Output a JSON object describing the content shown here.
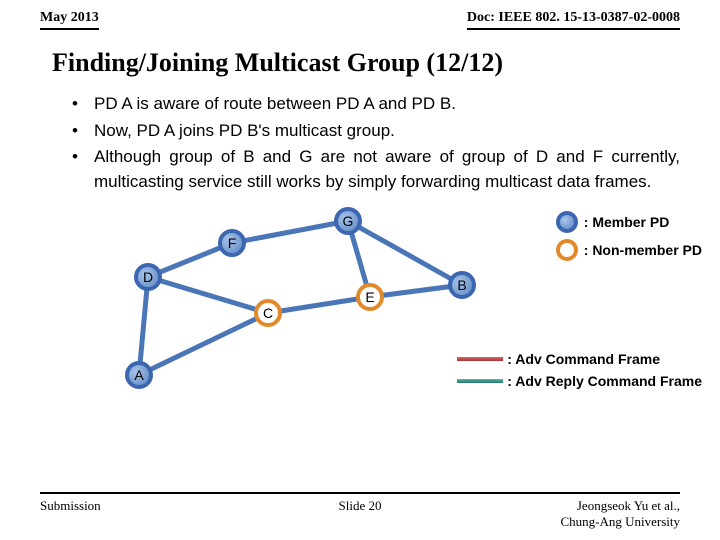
{
  "header": {
    "date": "May 2013",
    "doc": "Doc: IEEE 802. 15-13-0387-02-0008"
  },
  "title": "Finding/Joining Multicast Group (12/12)",
  "bullets": [
    "PD A is aware of route between PD A and PD B.",
    "Now, PD A joins PD B's multicast group.",
    "Although group of B and G are not aware of group of D and F currently, multicasting service still works by simply forwarding multicast data frames."
  ],
  "nodes": {
    "A": "A",
    "B": "B",
    "C": "C",
    "D": "D",
    "E": "E",
    "F": "F",
    "G": "G"
  },
  "legend": {
    "member": ": Member PD",
    "nonmember": ": Non-member PD",
    "cmd": ": Adv Command Frame",
    "reply": ": Adv Reply Command Frame"
  },
  "colors": {
    "member_border": "#3c66b0",
    "nonmember_border": "#e28a2a",
    "edge": "#4a76b8",
    "cmd_line": "#c44a4a",
    "reply_line": "#3d9a6a"
  },
  "footer": {
    "left": "Submission",
    "center": "Slide 20",
    "author": "Jeongseok Yu et al., ",
    "affil": "Chung-Ang University"
  }
}
